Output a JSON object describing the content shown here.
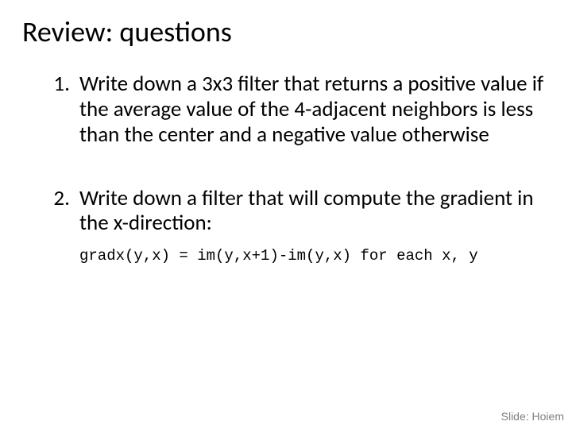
{
  "title": "Review: questions",
  "questions": [
    {
      "text": "Write down a 3x3 filter that returns a positive value if the average value of the 4-adjacent neighbors is less than the center and a negative value otherwise"
    },
    {
      "text": "Write down a filter that will compute the gradient in the x-direction:",
      "code": "gradx(y,x) = im(y,x+1)-im(y,x) for each x, y"
    }
  ],
  "credit": "Slide: Hoiem"
}
